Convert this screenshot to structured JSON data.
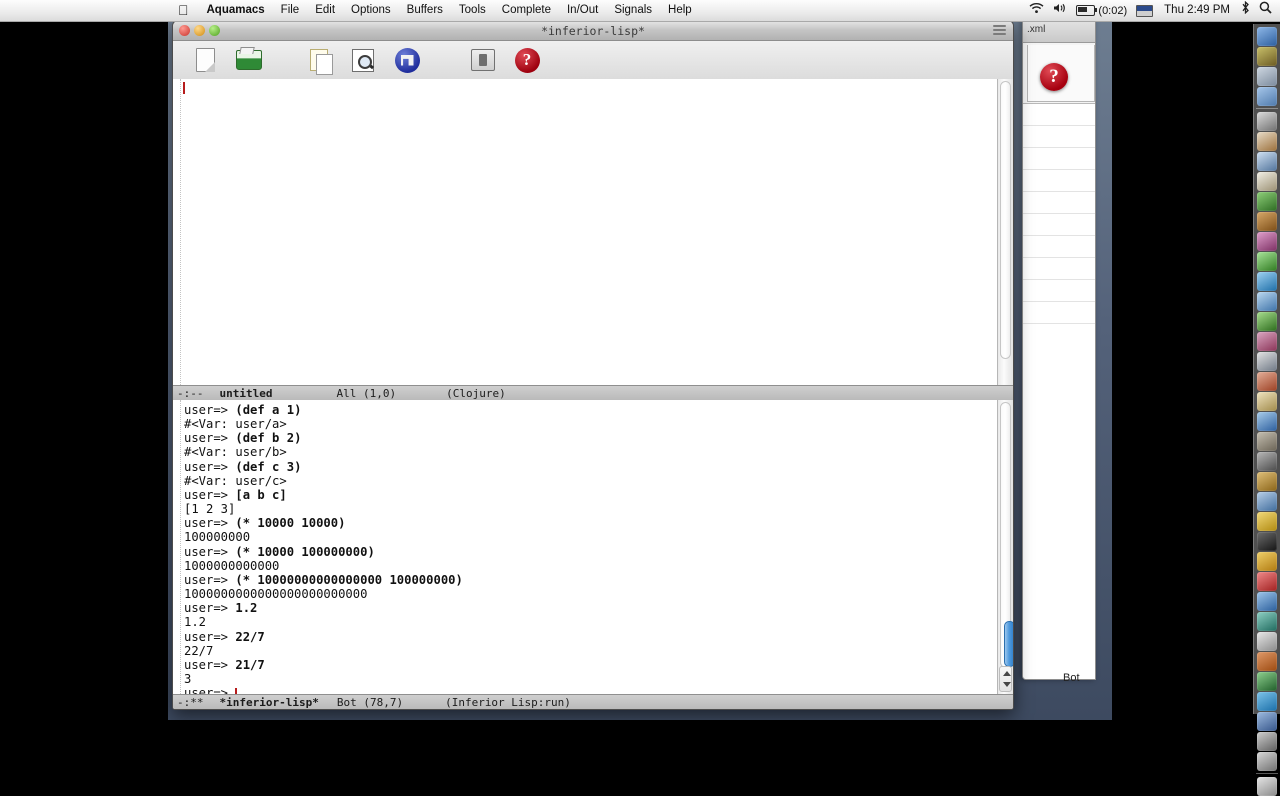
{
  "menubar": {
    "apple_glyph": "",
    "left_items": [
      {
        "label": "Aquamacs",
        "bold": true
      },
      {
        "label": "File",
        "bold": false
      },
      {
        "label": "Edit",
        "bold": false
      },
      {
        "label": "Options",
        "bold": false
      },
      {
        "label": "Buffers",
        "bold": false
      },
      {
        "label": "Tools",
        "bold": false
      },
      {
        "label": "Complete",
        "bold": false
      },
      {
        "label": "In/Out",
        "bold": false
      },
      {
        "label": "Signals",
        "bold": false
      },
      {
        "label": "Help",
        "bold": false
      }
    ],
    "status": {
      "wifi_icon": "wifi-icon",
      "volume_glyph": "◀))",
      "battery_time": "(0:02)",
      "input_menu_icon": "flag-icon",
      "clock": "Thu 2:49 PM",
      "bluetooth_glyph": "❂",
      "spotlight_glyph": "⌕"
    }
  },
  "window": {
    "title": "*inferior-lisp*",
    "toolbar": [
      {
        "name": "new-file",
        "label": "New"
      },
      {
        "name": "open-file",
        "label": "Open"
      },
      {
        "name": "copy",
        "label": "Copy"
      },
      {
        "name": "search",
        "label": "Search"
      },
      {
        "name": "save",
        "label": "Save"
      },
      {
        "name": "print",
        "label": "Print"
      },
      {
        "name": "help",
        "label": "Help",
        "glyph": "?"
      }
    ]
  },
  "top_buffer": {
    "content": "",
    "modeline": {
      "flags": "-:--",
      "name": "untitled",
      "position": "All (1,0)",
      "major_mode": "(Clojure)"
    }
  },
  "repl": {
    "prompt": "user=> ",
    "lines": [
      {
        "type": "input",
        "text": "(def a 1)"
      },
      {
        "type": "output",
        "text": "#<Var: user/a>"
      },
      {
        "type": "input",
        "text": "(def b 2)"
      },
      {
        "type": "output",
        "text": "#<Var: user/b>"
      },
      {
        "type": "input",
        "text": "(def c 3)"
      },
      {
        "type": "output",
        "text": "#<Var: user/c>"
      },
      {
        "type": "input",
        "text": "[a b c]"
      },
      {
        "type": "output",
        "text": "[1 2 3]"
      },
      {
        "type": "input",
        "text": "(* 10000 10000)"
      },
      {
        "type": "output",
        "text": "100000000"
      },
      {
        "type": "input",
        "text": "(* 10000 100000000)"
      },
      {
        "type": "output",
        "text": "1000000000000"
      },
      {
        "type": "input",
        "text": "(* 10000000000000000 100000000)"
      },
      {
        "type": "output",
        "text": "1000000000000000000000000"
      },
      {
        "type": "input",
        "text": "1.2"
      },
      {
        "type": "output",
        "text": "1.2"
      },
      {
        "type": "input",
        "text": "22/7"
      },
      {
        "type": "output",
        "text": "22/7"
      },
      {
        "type": "input",
        "text": "21/7"
      },
      {
        "type": "output",
        "text": "3"
      },
      {
        "type": "cursor",
        "text": ""
      }
    ],
    "modeline": {
      "flags": "-:**",
      "name": "*inferior-lisp*",
      "position": "Bot (78,7)",
      "major_mode": "(Inferior Lisp:run)"
    }
  },
  "background_window": {
    "tab_label": ".xml",
    "help_badge": "?",
    "bot_label": "Bot"
  },
  "colors": {
    "cursor": "#b61c1c",
    "modeline_bg": "#c3c3c3",
    "scrollbar_thumb": "#4f9ade",
    "desktop": "#54627a"
  }
}
